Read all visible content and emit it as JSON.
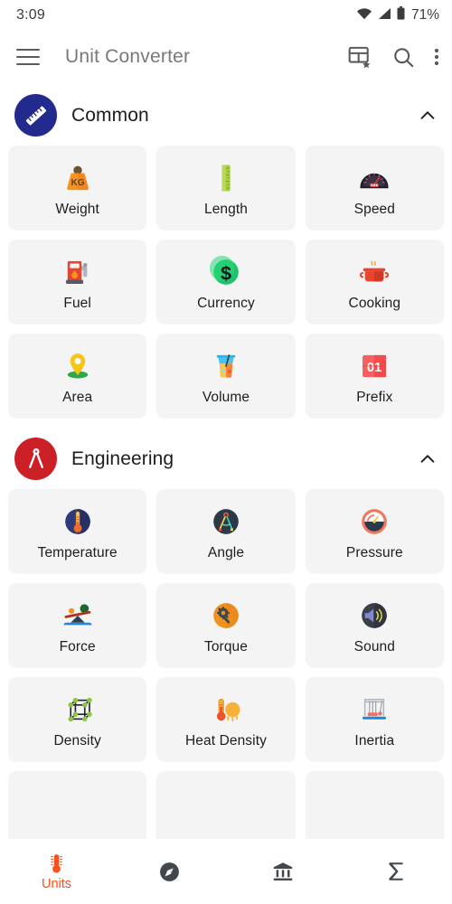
{
  "status_bar": {
    "time": "3:09",
    "battery_percent": "71%",
    "icons": [
      "wifi-icon",
      "cellular-signal-icon",
      "battery-icon"
    ]
  },
  "app_bar": {
    "menu_icon": "hamburger-menu-icon",
    "title": "Unit Converter",
    "actions": [
      {
        "name": "favorites-grid-icon",
        "label": "Favorites"
      },
      {
        "name": "search-icon",
        "label": "Search"
      },
      {
        "name": "overflow-menu-icon",
        "label": "More options"
      }
    ]
  },
  "sections": [
    {
      "id": "common",
      "title": "Common",
      "badge_icon": "ruler-icon",
      "badge_color": "#232a8e",
      "expanded": true,
      "collapse_icon": "chevron-up-icon",
      "items": [
        {
          "label": "Weight",
          "icon": "weight-kg-icon"
        },
        {
          "label": "Length",
          "icon": "ruler-green-icon"
        },
        {
          "label": "Speed",
          "icon": "speedometer-icon"
        },
        {
          "label": "Fuel",
          "icon": "fuel-pump-icon"
        },
        {
          "label": "Currency",
          "icon": "dollar-coin-icon"
        },
        {
          "label": "Cooking",
          "icon": "cooking-pot-icon"
        },
        {
          "label": "Area",
          "icon": "map-pin-icon"
        },
        {
          "label": "Volume",
          "icon": "blender-jug-icon"
        },
        {
          "label": "Prefix",
          "icon": "flip-number-01-icon"
        }
      ]
    },
    {
      "id": "engineering",
      "title": "Engineering",
      "badge_icon": "drafting-compass-icon",
      "badge_color": "#cc2027",
      "expanded": true,
      "collapse_icon": "chevron-up-icon",
      "items": [
        {
          "label": "Temperature",
          "icon": "thermometer-circle-icon"
        },
        {
          "label": "Angle",
          "icon": "compass-angle-icon"
        },
        {
          "label": "Pressure",
          "icon": "pressure-gauge-icon"
        },
        {
          "label": "Force",
          "icon": "seesaw-balance-icon"
        },
        {
          "label": "Torque",
          "icon": "wrench-gear-icon"
        },
        {
          "label": "Sound",
          "icon": "speaker-volume-icon"
        },
        {
          "label": "Density",
          "icon": "molecule-cube-icon"
        },
        {
          "label": "Heat Density",
          "icon": "thermometer-sun-icon"
        },
        {
          "label": "Inertia",
          "icon": "newtons-cradle-icon"
        }
      ]
    }
  ],
  "bottom_nav": {
    "active_index": 0,
    "items": [
      {
        "label": "Units",
        "icon": "thermometer-icon",
        "active": true
      },
      {
        "label": "",
        "icon": "compass-icon",
        "active": false
      },
      {
        "label": "",
        "icon": "bank-icon",
        "active": false
      },
      {
        "label": "",
        "icon": "sigma-icon",
        "active": false
      }
    ]
  },
  "colors": {
    "accent": "#f4511e",
    "card_bg": "#f4f4f4",
    "page_bg": "#ffffff",
    "title_gray": "#78787c",
    "text_dark": "#1d1d1d"
  }
}
